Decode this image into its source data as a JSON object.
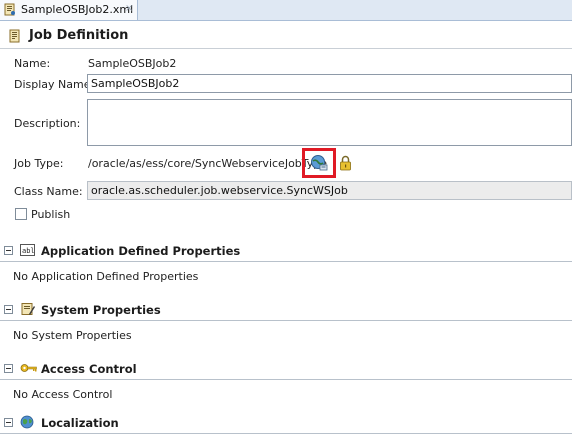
{
  "tab": {
    "label": "SampleOSBJob2.xml",
    "close": "×"
  },
  "job_definition": {
    "title": "Job Definition",
    "name_label": "Name:",
    "name_value": "SampleOSBJob2",
    "display_name_label": "Display Name:",
    "display_name_value": "SampleOSBJob2",
    "description_label": "Description:",
    "description_value": "",
    "job_type_label": "Job Type:",
    "job_type_value": "/oracle/as/ess/core/SyncWebserviceJobType",
    "class_name_label": "Class Name:",
    "class_name_value": "oracle.as.scheduler.job.webservice.SyncWSJob",
    "publish_label": "Publish",
    "publish_checked": false
  },
  "sections": {
    "application": {
      "title": "Application Defined Properties",
      "body": "No Application Defined Properties",
      "icon": "abl-properties-icon"
    },
    "system": {
      "title": "System Properties",
      "body": "No System Properties",
      "icon": "system-properties-icon"
    },
    "access": {
      "title": "Access Control",
      "body": "No Access Control",
      "icon": "key-icon"
    },
    "localization": {
      "title": "Localization",
      "icon": "globe-icon"
    }
  },
  "colors": {
    "highlight": "#e01a25",
    "tab_strip": "#dfe8f3"
  }
}
